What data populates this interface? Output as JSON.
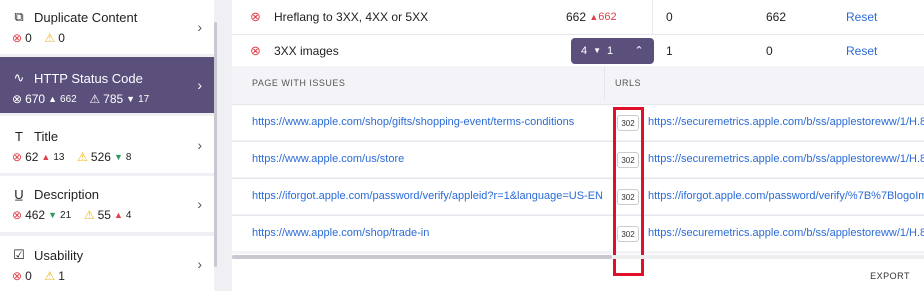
{
  "sidebar": {
    "cards": [
      {
        "icon": "⧉",
        "title": "Duplicate Content",
        "errors": "0",
        "warnings": "0"
      },
      {
        "icon": "∿",
        "title": "HTTP Status Code",
        "errors": "670",
        "err_delta": "662",
        "warnings": "785",
        "warn_delta": "17"
      },
      {
        "icon": "T",
        "title": "Title",
        "errors": "62",
        "err_delta": "13",
        "warnings": "526",
        "warn_delta": "8"
      },
      {
        "icon": "U̲",
        "title": "Description",
        "errors": "462",
        "err_delta": "21",
        "warnings": "55",
        "warn_delta": "4"
      },
      {
        "icon": "☑",
        "title": "Usability",
        "errors": "0",
        "warnings": "1"
      }
    ]
  },
  "issues": [
    {
      "name": "Hreflang to 3XX, 4XX or 5XX",
      "count": "662",
      "delta": "662",
      "c2": "0",
      "c3": "662",
      "action": "Reset"
    },
    {
      "name": "3XX images",
      "count": "4",
      "delta": "1",
      "c2": "1",
      "c3": "0",
      "action": "Reset"
    }
  ],
  "subtable": {
    "col1": "PAGE WITH ISSUES",
    "col2": "URLS",
    "rows": [
      {
        "page": "https://www.apple.com/shop/gifts/shopping-event/terms-conditions",
        "code": "302",
        "target": "https://securemetrics.apple.com/b/ss/applestoreww/1/H.8-"
      },
      {
        "page": "https://www.apple.com/us/store",
        "code": "302",
        "target": "https://securemetrics.apple.com/b/ss/applestoreww/1/H.8-"
      },
      {
        "page": "https://iforgot.apple.com/password/verify/appleid?r=1&language=US-EN",
        "code": "302",
        "target": "https://iforgot.apple.com/password/verify/%7B%7BlogoIm"
      },
      {
        "page": "https://www.apple.com/shop/trade-in",
        "code": "302",
        "target": "https://securemetrics.apple.com/b/ss/applestoreww/1/H.8-"
      }
    ],
    "export": "EXPORT"
  }
}
